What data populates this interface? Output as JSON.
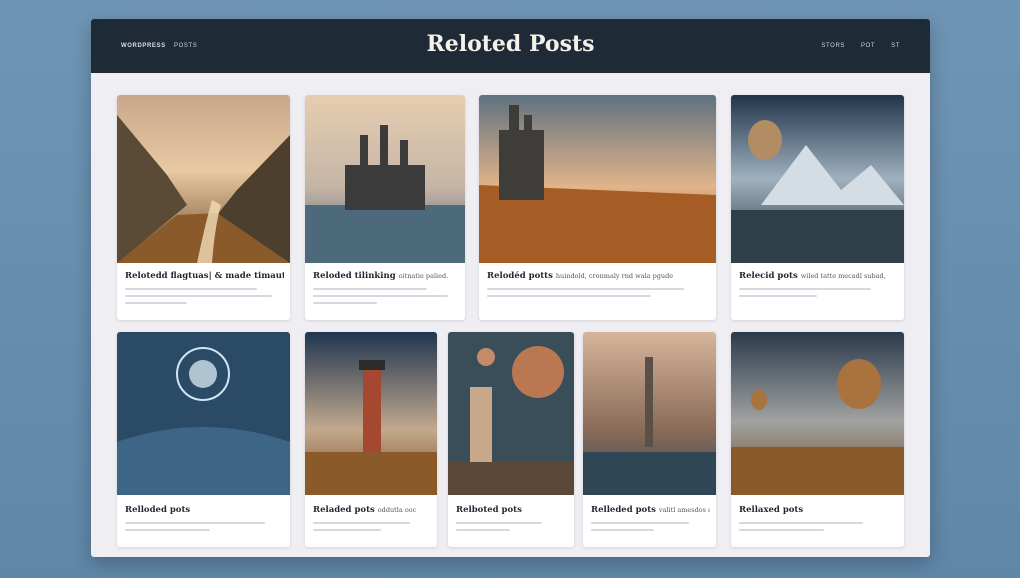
{
  "header": {
    "brand": "WORDPRESS",
    "left_link": "POSTS",
    "title": "Reloted Posts",
    "right_links": [
      "STORS",
      "POT",
      "ST"
    ]
  },
  "cards": [
    {
      "title": "Relotedd flagtuas| & made timauta ta ala",
      "subtitle": ""
    },
    {
      "title": "Reloded tilinking",
      "subtitle": "oitnatie palied."
    },
    {
      "title": "Relodéd potts",
      "subtitle": "huindold, cronmaly rnd wala pgude"
    },
    {
      "title": "Relecid pots",
      "subtitle": "wiled tatte mecadl subad,"
    },
    {
      "title": "Relloded pots",
      "subtitle": ""
    },
    {
      "title": "Reladed pots",
      "subtitle": "oddutla ooc"
    },
    {
      "title": "Relboted pots",
      "subtitle": ""
    },
    {
      "title": "Relleded pots",
      "subtitle": "valitl amesdos aened."
    },
    {
      "title": "Rellaxed pots",
      "subtitle": ""
    }
  ]
}
